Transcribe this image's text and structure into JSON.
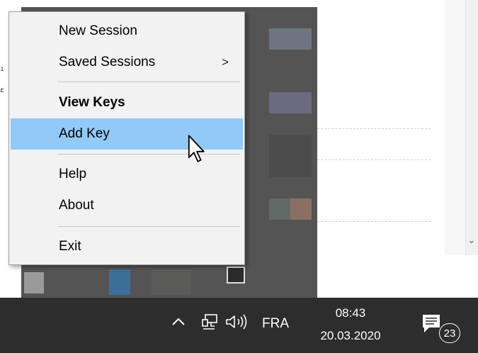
{
  "context_menu": {
    "items": [
      {
        "label": "New Session"
      },
      {
        "label": "Saved Sessions",
        "submenu_arrow": ">"
      },
      {
        "label": "View Keys"
      },
      {
        "label": "Add Key"
      },
      {
        "label": "Help"
      },
      {
        "label": "About"
      },
      {
        "label": "Exit"
      }
    ],
    "highlighted": "Add Key",
    "default_item": "View Keys"
  },
  "taskbar": {
    "language": "FRA",
    "time": "08:43",
    "date": "20.03.2020",
    "notification_count": "23"
  },
  "background": {
    "scroll_arrow": "⌄"
  },
  "icons": [
    "chevron-up-icon",
    "network-icon",
    "volume-icon",
    "notification-icon",
    "mouse-cursor-icon",
    "submenu-arrow-icon",
    "scroll-down-icon"
  ],
  "colors": {
    "menu_highlight": "#91c9f7",
    "menu_background": "#f2f2f2",
    "taskbar": "#2d2d2d",
    "tray_overflow": "#545454"
  }
}
